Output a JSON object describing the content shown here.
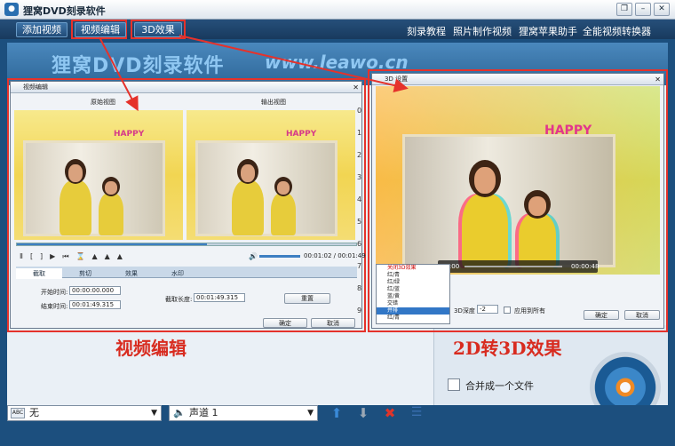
{
  "app": {
    "title": "狸窝DVD刻录软件"
  },
  "toolbar": {
    "buttons": [
      "添加视频",
      "视频编辑",
      "3D效果"
    ],
    "links": [
      "刻录教程",
      "照片制作视频",
      "狸窝苹果助手",
      "全能视频转换器"
    ]
  },
  "banner": {
    "title": "狸窝DVD刻录软件",
    "url": "www.leawo.cn"
  },
  "edit_window": {
    "title": "视频编辑",
    "preview_labels": [
      "原始视图",
      "输出视图"
    ],
    "time": "00:01:02 / 00:01:49",
    "tabs": [
      "截取",
      "剪切",
      "效果",
      "水印"
    ],
    "start_label": "开始时间:",
    "start_value": "00:00:00.000",
    "end_label": "结束时间:",
    "end_value": "00:01:49.315",
    "length_label": "截取长度:",
    "length_value": "00:01:49.315",
    "reset": "重置",
    "ok": "确定",
    "cancel": "取消",
    "photo_text": "HAPPY",
    "track_numbers": [
      "0",
      "1",
      "2",
      "3",
      "4",
      "5",
      "6",
      "7",
      "8",
      "9"
    ]
  },
  "effect_window": {
    "title": "3D 设置",
    "time": "00:00:48",
    "time_start": "00:00",
    "photo_text": "HAPPY",
    "menu_items": [
      "关闭3D效果",
      "红/青",
      "红/绿",
      "红/蓝",
      "蓝/黄",
      "交错",
      "并排",
      "红/青"
    ],
    "depth_label": "3D深度",
    "depth_value": "-2",
    "apply_all": "应用到所有",
    "ok": "确定",
    "cancel": "取消"
  },
  "captions": {
    "edit": "视频编辑",
    "effect": "2D转3D效果"
  },
  "merge_label": "合并成一个文件",
  "bottom": {
    "subtitle": "无",
    "subtitle_icon": "ABC",
    "audio": "声道 1"
  },
  "colors": {
    "annotation": "#e5322b",
    "accent": "#1c4f7e"
  }
}
